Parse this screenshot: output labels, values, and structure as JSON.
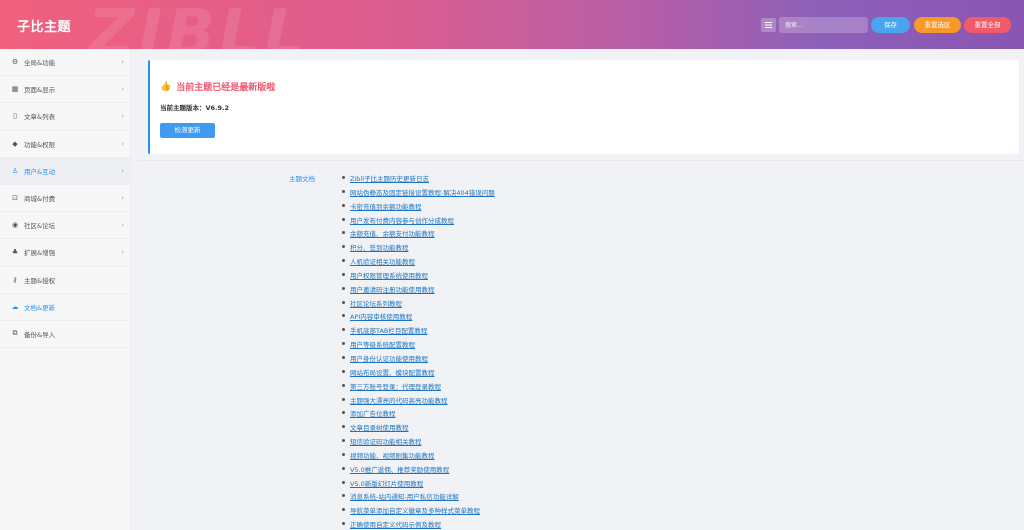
{
  "header": {
    "brand": "子比主题",
    "watermark": "ZIBLL",
    "search_placeholder": "搜索...",
    "save_label": "保存",
    "reset_section_label": "重置选区",
    "reset_all_label": "重置全部",
    "colors": {
      "save": "#4aa5f0",
      "reset_section": "#f7982b",
      "reset_all": "#f25a6a"
    }
  },
  "sidebar": {
    "items": [
      {
        "label": "全局&功能",
        "icon": "gear-icon",
        "glyph": "⚙",
        "chevron": true
      },
      {
        "label": "页面&显示",
        "icon": "calendar-icon",
        "glyph": "▦",
        "chevron": true
      },
      {
        "label": "文章&列表",
        "icon": "book-icon",
        "glyph": "▯",
        "chevron": true
      },
      {
        "label": "功能&权限",
        "icon": "shield-icon",
        "glyph": "◆",
        "chevron": true
      },
      {
        "label": "用户&互动",
        "icon": "user-icon",
        "glyph": "♙",
        "chevron": true,
        "active": true
      },
      {
        "label": "商城&付费",
        "icon": "cart-icon",
        "glyph": "⊡",
        "chevron": true
      },
      {
        "label": "社区&论坛",
        "icon": "community-icon",
        "glyph": "◉",
        "chevron": true
      },
      {
        "label": "扩展&增强",
        "icon": "puzzle-icon",
        "glyph": "♣",
        "chevron": true
      },
      {
        "label": "主题&授权",
        "icon": "key-icon",
        "glyph": "⚷",
        "chevron": false
      },
      {
        "label": "文档&更新",
        "icon": "cloud-icon",
        "glyph": "☁",
        "chevron": false,
        "current": true
      },
      {
        "label": "备份&导入",
        "icon": "copy-icon",
        "glyph": "⧉",
        "chevron": false
      }
    ]
  },
  "notice": {
    "title": "当前主题已经是最新版啦",
    "version_text": "当前主题版本：V6.9.2",
    "check_button": "检测更新"
  },
  "docs": {
    "label": "主题文档",
    "links": [
      "Zibll子比主题历史更新日志",
      "网站伪静态及固定链接设置教程-解决404错误问题",
      "卡密充值到余额功能教程",
      "用户发布付费内容参与创作分成教程",
      "余额充值、余额支付功能教程",
      "积分、签到功能教程",
      "人机验证相关功能教程",
      "用户权限管理系统使用教程",
      "用户邀请码注册功能使用教程",
      "社区论坛系列教程",
      "API内容审核使用教程",
      "手机底部TAB栏目配置教程",
      "用户等级系统配置教程",
      "用户身份认证功能使用教程",
      "网站布局设置、模块配置教程",
      "第三方账号登录：代理登录教程",
      "主题强大漂亮的代码高亮功能教程",
      "添加广告位教程",
      "文章目录树使用教程",
      "短信验证码功能相关教程",
      "视频功能、视频剧集功能教程",
      "V5.0推广返佣、推荐奖励使用教程",
      "V5.0新版幻灯片使用教程",
      "消息系统-站内通知-用户私信功能详解",
      "导航菜单添加自定义徽章及多种样式菜单教程",
      "正确使用自定义代码示例及教程"
    ]
  }
}
